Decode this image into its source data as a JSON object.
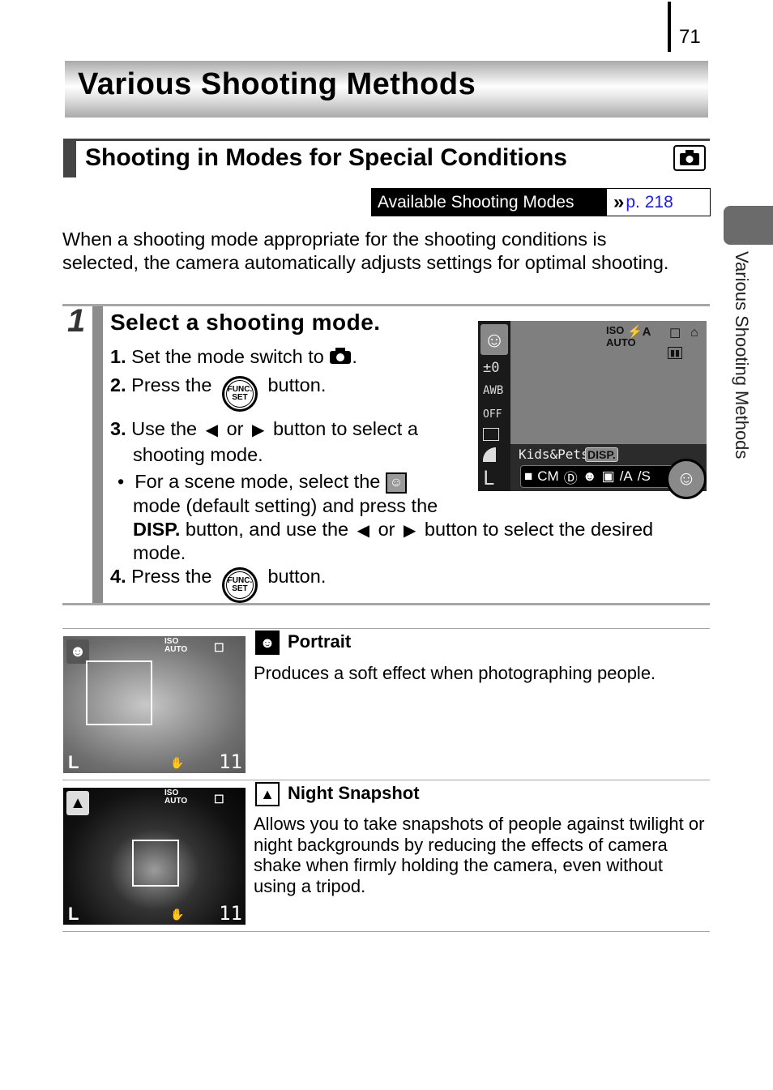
{
  "page_number": "71",
  "chapter_title": "Various Shooting Methods",
  "side_tab_label": "Various Shooting Methods",
  "section": {
    "title": "Shooting in Modes for Special Conditions",
    "mode_icon": "camera-icon"
  },
  "available_modes": {
    "label": "Available Shooting Modes",
    "link_arrow": "»",
    "link_text": "p. 218"
  },
  "intro": "When a shooting mode appropriate for the shooting conditions is selected, the camera automatically adjusts settings for optimal shooting.",
  "step": {
    "number": "1",
    "title": "Select a shooting mode.",
    "items": [
      {
        "num": "1.",
        "before": "Set the mode switch to",
        "after": "."
      },
      {
        "num": "2.",
        "before": "Press the",
        "after": "button."
      },
      {
        "num": "3.",
        "before": "Use the",
        "or": "or",
        "after": "button to select a",
        "line2": "shooting mode."
      },
      {
        "bullet": "•",
        "line1": "For a scene mode, select the",
        "line2": "mode (default setting) and press the",
        "line3_bold": "DISP.",
        "line3": "button, and use the",
        "line3_or": "or",
        "line3_after": "button to select the desired",
        "line4": "mode."
      },
      {
        "num": "4.",
        "before": "Press the",
        "after": "button."
      }
    ],
    "func_button": {
      "top": "FUNC.",
      "bottom": "SET"
    },
    "arrows": {
      "left": "◆",
      "right": "◆"
    }
  },
  "camera_screen": {
    "side_values": [
      "±0",
      "AWB",
      "OFF",
      "L"
    ],
    "top_iso": [
      "ISO",
      "AUTO"
    ],
    "flash": "⚡A",
    "mode_label": "Kids&Pets",
    "disp_label": "DISP.",
    "strip_icons": [
      "camera-icon",
      "cm-icon",
      "d-icon",
      "portrait-icon",
      "night-snapshot-icon",
      "foliage-icon",
      "snow-icon"
    ],
    "selected_mode": "kids-pets-icon"
  },
  "modes": [
    {
      "name": "Portrait",
      "icon": "portrait-icon",
      "description": "Produces a soft effect when photographing people.",
      "shot_count": "11"
    },
    {
      "name": "Night Snapshot",
      "icon": "night-snapshot-icon",
      "description": "Allows you to take snapshots of people against twilight or night backgrounds by reducing the effects of camera shake when firmly holding the camera, even without using a tripod.",
      "shot_count": "11"
    }
  ]
}
